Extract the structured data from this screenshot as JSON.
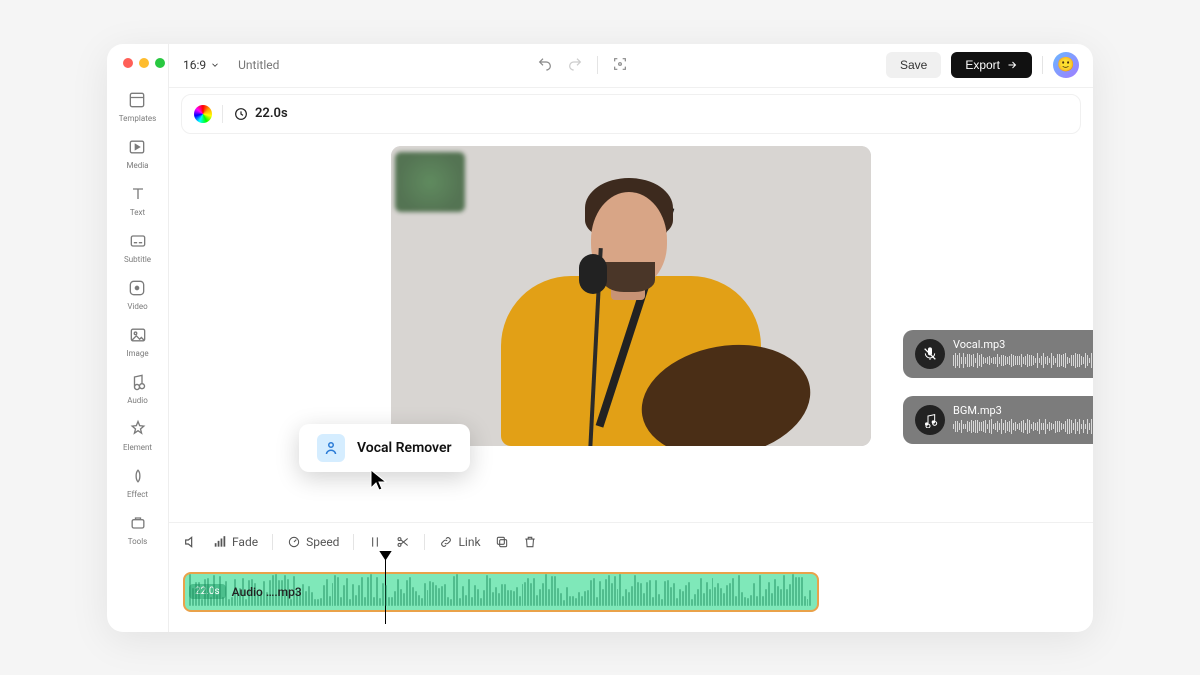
{
  "header": {
    "aspect_ratio": "16:9",
    "project_title": "Untitled",
    "save_label": "Save",
    "export_label": "Export"
  },
  "info": {
    "time": "22.0s"
  },
  "sidebar": {
    "items": [
      {
        "label": "Templates"
      },
      {
        "label": "Media"
      },
      {
        "label": "Text"
      },
      {
        "label": "Subtitle"
      },
      {
        "label": "Video"
      },
      {
        "label": "Image"
      },
      {
        "label": "Audio"
      },
      {
        "label": "Element"
      },
      {
        "label": "Effect"
      },
      {
        "label": "Tools"
      }
    ]
  },
  "tooltip": {
    "label": "Vocal Remover"
  },
  "audio_cards": {
    "vocal": {
      "label": "Vocal.mp3"
    },
    "bgm": {
      "label": "BGM.mp3"
    }
  },
  "toolbar": {
    "fade": "Fade",
    "speed": "Speed",
    "link": "Link"
  },
  "timeline": {
    "badge": "22.0s",
    "clip_name": "Audio ….mp3"
  }
}
